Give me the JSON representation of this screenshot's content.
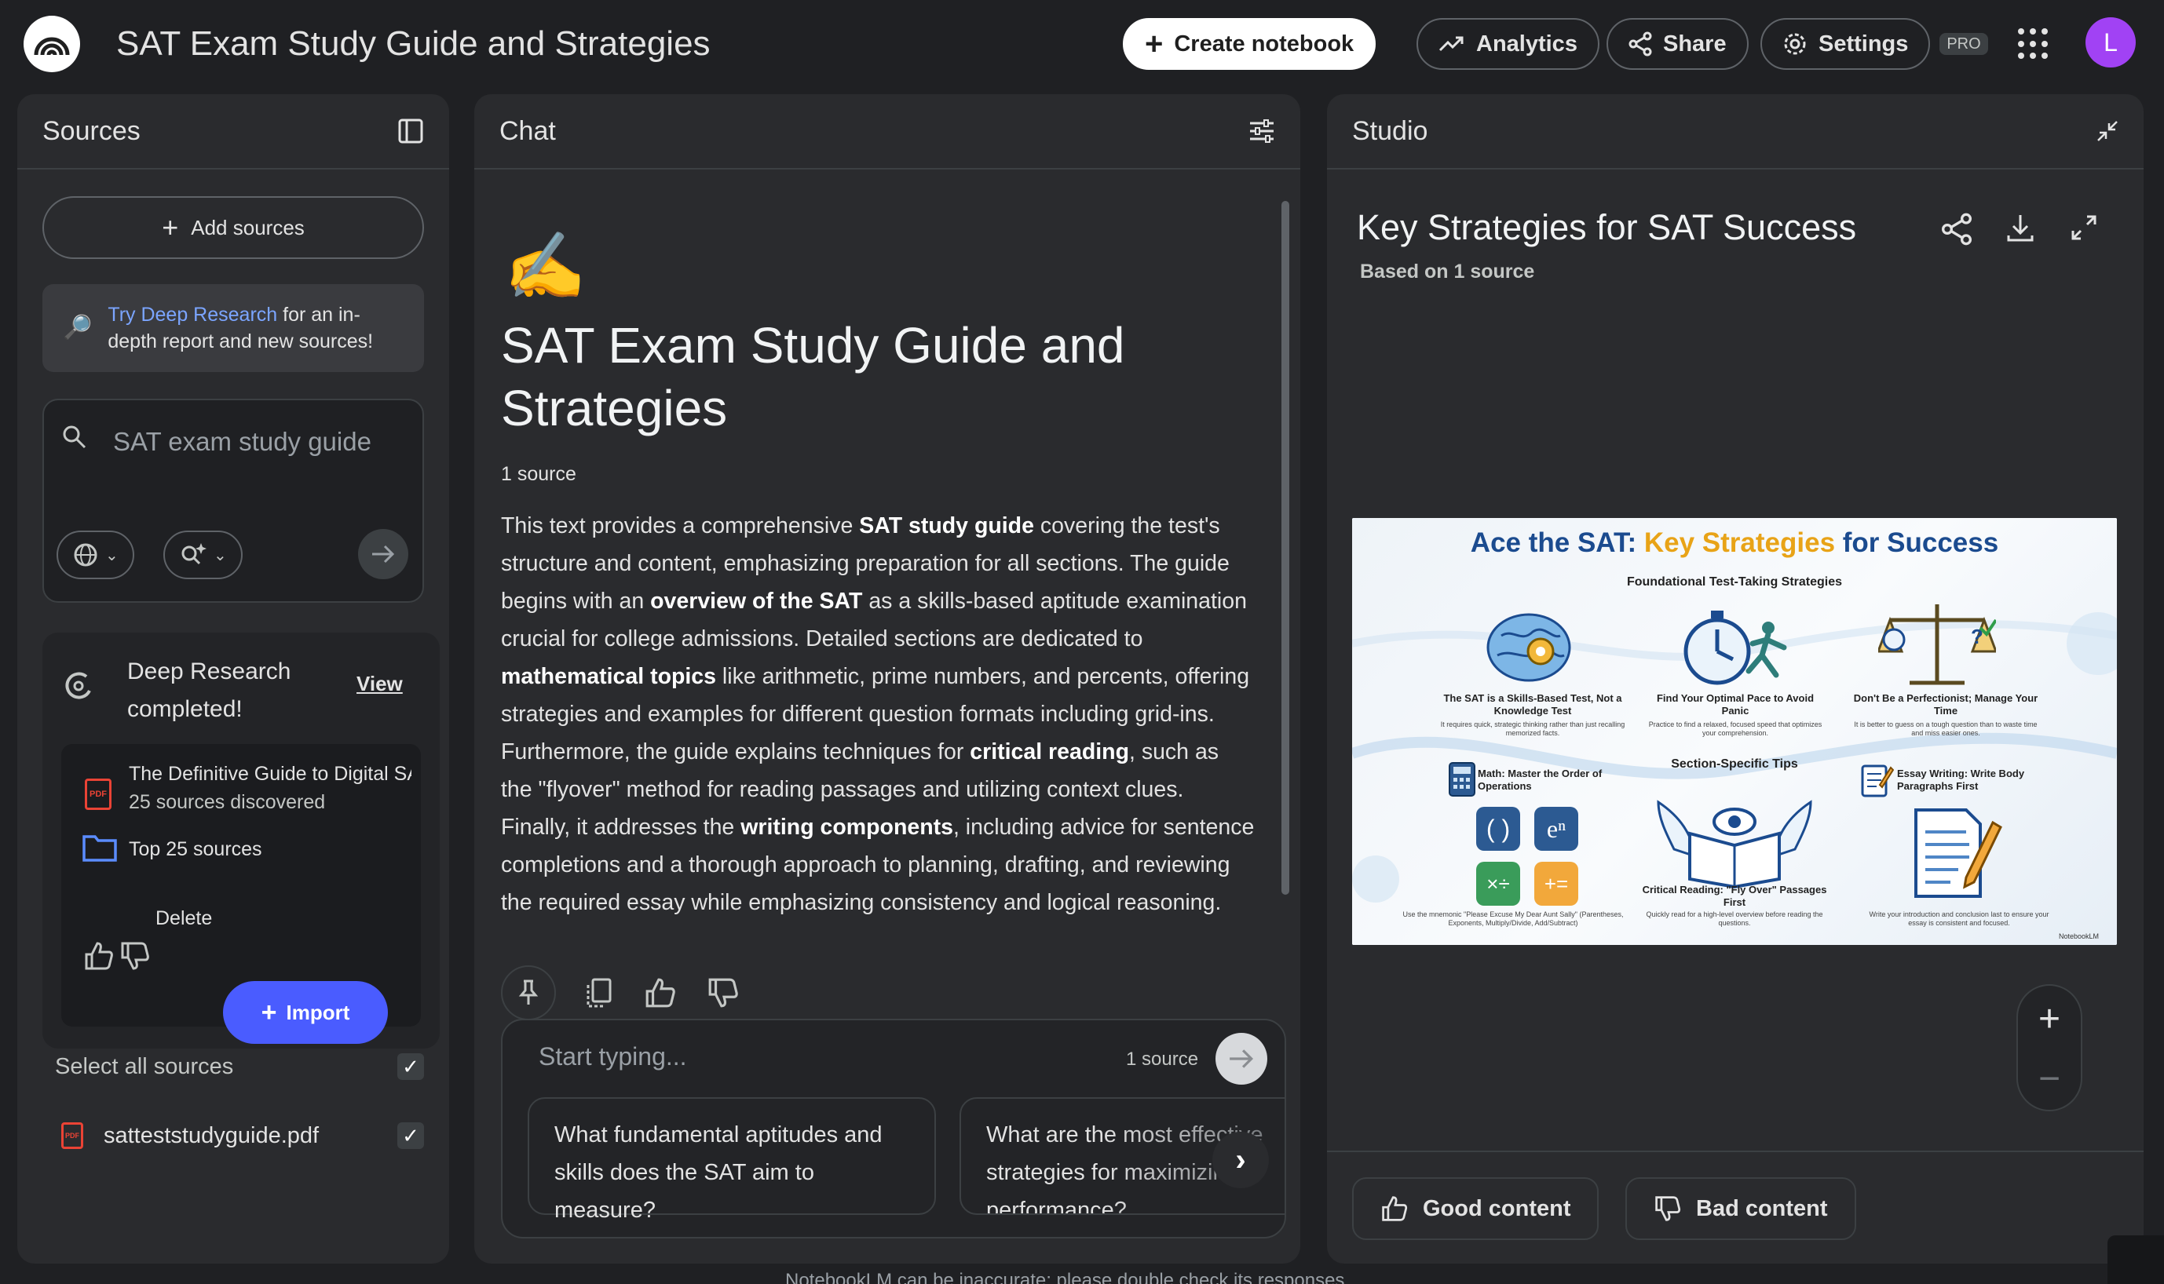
{
  "app": {
    "title": "SAT Exam Study Guide and Strategies",
    "create_label": "Create notebook",
    "analytics_label": "Analytics",
    "share_label": "Share",
    "settings_label": "Settings",
    "pro_badge": "PRO",
    "avatar_letter": "L",
    "disclaimer": "NotebookLM can be inaccurate; please double check its responses."
  },
  "sources": {
    "title": "Sources",
    "add_label": "Add sources",
    "deep_link": "Try Deep Research",
    "deep_text": " for an in-depth report and new sources!",
    "search_placeholder": "SAT exam study guide",
    "dr_title": "Deep Research completed!",
    "dr_view": "View",
    "dr_doc_title": "The Definitive Guide to Digital SAT",
    "dr_doc_sub": "25 sources discovered",
    "dr_top": "Top 25 sources",
    "dr_delete": "Delete",
    "dr_import": "Import",
    "select_all": "Select all sources",
    "file_name": "satteststudyguide.pdf"
  },
  "chat": {
    "title": "Chat",
    "emoji": "✍️",
    "notebook_title": "SAT Exam Study Guide and Strategies",
    "source_count": "1 source",
    "summary": [
      {
        "t": "This text provides a comprehensive ",
        "b": false
      },
      {
        "t": "SAT study guide",
        "b": true
      },
      {
        "t": " covering the test's structure and content, emphasizing preparation for all sections. The guide begins with an ",
        "b": false
      },
      {
        "t": "overview of the SAT",
        "b": true
      },
      {
        "t": " as a skills-based aptitude examination crucial for college admissions. Detailed sections are dedicated to ",
        "b": false
      },
      {
        "t": "mathematical topics",
        "b": true
      },
      {
        "t": " like arithmetic, prime numbers, and percents, offering strategies and examples for different question formats including grid-ins. Furthermore, the guide explains techniques for ",
        "b": false
      },
      {
        "t": "critical reading",
        "b": true
      },
      {
        "t": ", such as the \"flyover\" method for reading passages and utilizing context clues. Finally, it addresses the ",
        "b": false
      },
      {
        "t": "writing components",
        "b": true
      },
      {
        "t": ", including advice for sentence completions and a thorough approach to planning, drafting, and reviewing the required essay while emphasizing consistency and logical reasoning.",
        "b": false
      }
    ],
    "input_placeholder": "Start typing...",
    "input_source_count": "1 source",
    "suggestion_1": "What fundamental aptitudes and skills does the SAT aim to measure?",
    "suggestion_2": "What are the most effective strategies for maximizing performance?"
  },
  "studio": {
    "title": "Studio",
    "note_title": "Key Strategies for SAT Success",
    "note_sub": "Based on 1 source",
    "good_label": "Good content",
    "bad_label": "Bad content",
    "infographic": {
      "title_a": "Ace the SAT: ",
      "title_b": "Key Strategies",
      "title_c": " for Success",
      "section1": "Foundational Test-Taking Strategies",
      "c1_head": "The SAT is a Skills-Based Test, Not a Knowledge Test",
      "c1_body": "It requires quick, strategic thinking rather than just recalling memorized facts.",
      "c2_head": "Find Your Optimal Pace to Avoid Panic",
      "c2_body": "Practice to find a relaxed, focused speed that optimizes your comprehension.",
      "c3_head": "Don't Be a Perfectionist; Manage Your Time",
      "c3_body": "It is better to guess on a tough question than to waste time and miss easier ones.",
      "section2": "Section-Specific Tips",
      "math_head": "Math: Master the Order of Operations",
      "essay_head": "Essay Writing: Write Body Paragraphs First",
      "cr_head": "Critical Reading: \"Fly Over\" Passages First",
      "cr_body": "Quickly read for a high-level overview before reading the questions.",
      "math_body": "Use the mnemonic \"Please Excuse My Dear Aunt Sally\" (Parentheses, Exponents, Multiply/Divide, Add/Subtract)",
      "essay_body": "Write your introduction and conclusion last to ensure your essay is consistent and focused.",
      "brand": "NotebookLM"
    }
  },
  "colors": {
    "accent": "#4a5cff",
    "link": "#7ba5ff",
    "panel": "#2a2b2e",
    "background": "#1f2023",
    "avatar": "#a142f4"
  }
}
